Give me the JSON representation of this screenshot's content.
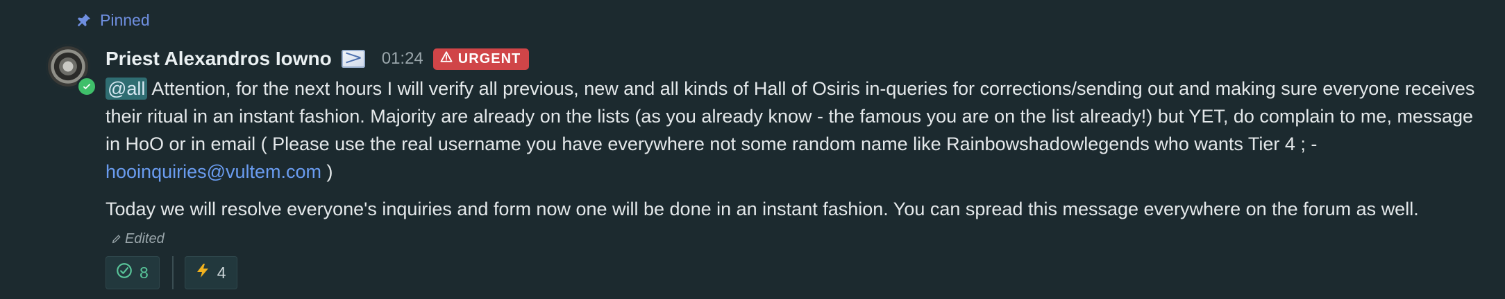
{
  "pinned": {
    "icon": "pin-icon",
    "label": "Pinned"
  },
  "message": {
    "author": "Priest Alexandros Iowno",
    "emoji_icon": "envelope-icon",
    "time": "01:24",
    "badge": {
      "icon": "warning-icon",
      "text": "URGENT",
      "color": "#d04548"
    },
    "paragraph1": {
      "mention": "@all",
      "text": " Attention, for the next hours I will verify all previous, new and all kinds of Hall of Osiris in-queries for corrections/sending out and making sure everyone receives their ritual in an instant fashion. Majority are already on the lists (as you already know - the famous you are on the list already!) but YET, do complain to me, message in HoO or in email ( Please use the real username you have everywhere not some random name like Rainbowshadowlegends who wants Tier 4 ; - ",
      "email": "hooinquiries@vultem.com",
      "tail": " )"
    },
    "paragraph2": {
      "text": "Today we will resolve everyone's inquiries and form now one will be done in an instant fashion. You can spread this message everywhere on the forum as well.",
      "edited": "Edited"
    }
  },
  "reactions": [
    {
      "icon": "check-circle-icon",
      "count": "8"
    },
    {
      "icon": "lightning-icon",
      "count": "4"
    }
  ]
}
